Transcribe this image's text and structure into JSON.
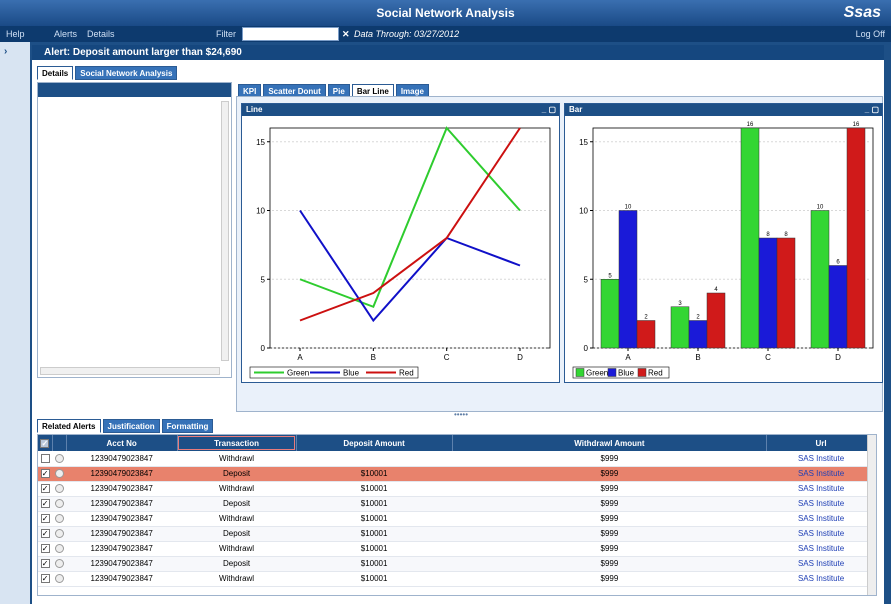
{
  "window": {
    "title": "Social Network Analysis",
    "logo": "Ssas"
  },
  "menu": {
    "help": "Help",
    "alerts": "Alerts",
    "details": "Details",
    "filter_label": "Filter",
    "filter_value": "",
    "clear": "✕",
    "data_through": "Data Through: 03/27/2012",
    "logoff": "Log Off"
  },
  "alert": {
    "title": "Alert:  Deposit amount larger than $24,690"
  },
  "top_tabs": [
    "Details",
    "Social Network Analysis"
  ],
  "chart_tabs": [
    "KPI",
    "Scatter Donut",
    "Pie",
    "Bar Line",
    "Image"
  ],
  "bottom_tabs": [
    "Related Alerts",
    "Justification",
    "Formatting"
  ],
  "charts": {
    "line_title": "Line",
    "bar_title": "Bar"
  },
  "chart_data": [
    {
      "type": "line",
      "title": "Line",
      "categories": [
        "A",
        "B",
        "C",
        "D"
      ],
      "ylim": [
        0,
        16
      ],
      "yticks": [
        0,
        5,
        10,
        15
      ],
      "series": [
        {
          "name": "Green",
          "color": "#2ecc2e",
          "values": [
            5,
            3,
            16,
            10
          ]
        },
        {
          "name": "Blue",
          "color": "#1010c8",
          "values": [
            10,
            2,
            8,
            6
          ]
        },
        {
          "name": "Red",
          "color": "#cc1010",
          "values": [
            2,
            4,
            8,
            16
          ]
        }
      ],
      "legend": "bottom-left"
    },
    {
      "type": "bar",
      "title": "Bar",
      "categories": [
        "A",
        "B",
        "C",
        "D"
      ],
      "ylim": [
        0,
        16
      ],
      "yticks": [
        0,
        5,
        10,
        15
      ],
      "series": [
        {
          "name": "Green",
          "color": "#33d633",
          "values": [
            5,
            3,
            16,
            10
          ]
        },
        {
          "name": "Blue",
          "color": "#1a1ad8",
          "values": [
            10,
            2,
            8,
            6
          ]
        },
        {
          "name": "Red",
          "color": "#d01a1a",
          "values": [
            2,
            4,
            8,
            16
          ]
        }
      ],
      "legend": "bottom-left"
    }
  ],
  "table": {
    "headers": [
      "Acct No",
      "Transaction",
      "Deposit Amount",
      "Withdrawl Amount",
      "Url"
    ],
    "rows": [
      {
        "checked": false,
        "acct": "12390479023847",
        "trans": "Withdrawl",
        "dep": "",
        "wd": "$999",
        "url": "SAS Institute"
      },
      {
        "checked": true,
        "acct": "12390479023847",
        "trans": "Deposit",
        "dep": "$10001",
        "wd": "$999",
        "url": "SAS Institute",
        "selected": true
      },
      {
        "checked": true,
        "acct": "12390479023847",
        "trans": "Withdrawl",
        "dep": "$10001",
        "wd": "$999",
        "url": "SAS Institute"
      },
      {
        "checked": true,
        "acct": "12390479023847",
        "trans": "Deposit",
        "dep": "$10001",
        "wd": "$999",
        "url": "SAS Institute"
      },
      {
        "checked": true,
        "acct": "12390479023847",
        "trans": "Withdrawl",
        "dep": "$10001",
        "wd": "$999",
        "url": "SAS Institute"
      },
      {
        "checked": true,
        "acct": "12390479023847",
        "trans": "Deposit",
        "dep": "$10001",
        "wd": "$999",
        "url": "SAS Institute"
      },
      {
        "checked": true,
        "acct": "12390479023847",
        "trans": "Withdrawl",
        "dep": "$10001",
        "wd": "$999",
        "url": "SAS Institute"
      },
      {
        "checked": true,
        "acct": "12390479023847",
        "trans": "Deposit",
        "dep": "$10001",
        "wd": "$999",
        "url": "SAS Institute"
      },
      {
        "checked": true,
        "acct": "12390479023847",
        "trans": "Withdrawl",
        "dep": "$10001",
        "wd": "$999",
        "url": "SAS Institute"
      }
    ]
  }
}
